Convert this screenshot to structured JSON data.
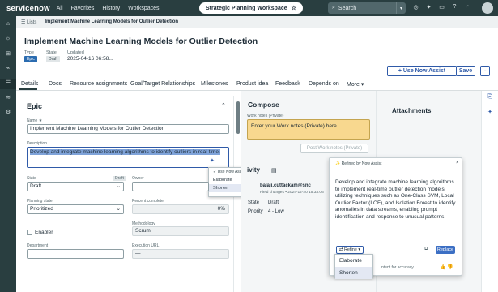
{
  "topbar": {
    "logo": "servicenow",
    "nav": [
      "All",
      "Favorites",
      "History",
      "Workspaces"
    ],
    "workspace": "Strategic Planning Workspace",
    "search_placeholder": "Search"
  },
  "tabsbar": {
    "list_tab": "Lists",
    "current_tab": "Implement Machine Learning Models for Outlier Detection"
  },
  "record": {
    "title": "Implement Machine Learning Models for Outlier Detection",
    "type_label": "Type",
    "type_value": "Epic",
    "state_label": "State",
    "state_value": "Draft",
    "updated_label": "Updated",
    "updated_value": "2025-04-16 06:58..."
  },
  "actions": {
    "use_now_assist": "+ Use Now Assist",
    "save": "Save",
    "more": "···"
  },
  "form_tabs": [
    "Details",
    "Docs",
    "Resource assignments",
    "Goal/Target Relationships",
    "Milestones",
    "Product idea",
    "Feedback",
    "Depends on",
    "More ▾"
  ],
  "form": {
    "section": "Epic",
    "name_label": "Name ★",
    "name_value": "Implement Machine Learning Models for Outlier Detection",
    "description_label": "Description",
    "description_value": "Develop and integrate machine learning algorithms to identify outliers in real-time.",
    "state_label": "State",
    "state_badge": "Draft",
    "state_value": "Draft",
    "owner_label": "Owner",
    "planning_state_label": "Planning state",
    "planning_state_value": "Prioritized",
    "percent_label": "Percent complete",
    "percent_value": "0%",
    "methodology_label": "Methodology",
    "methodology_value": "Scrum",
    "enabler_label": "Enabler",
    "department_label": "Department",
    "execution_url_label": "Execution URL",
    "execution_url_value": "—"
  },
  "desc_menu": {
    "header": "✓ Use Now Assist to...",
    "items": [
      "Elaborate",
      "Shorten"
    ]
  },
  "compose": {
    "title": "Compose",
    "notes_label": "Work notes (Private)",
    "notes_placeholder": "Enter your Work notes (Private) here",
    "post_button": "Post Work notes (Private)"
  },
  "activity": {
    "title": "ivity",
    "user": "balaji.cuttackam@snc",
    "change": "Field changes • 2024-12-20 15:33:06",
    "state_label": "State",
    "state_value": "Draft",
    "priority_label": "Priority",
    "priority_value": "4 - Low"
  },
  "attachments": {
    "title": "Attachments"
  },
  "assist_panel": {
    "header": "✨ Refined by Now Assist",
    "body": "Develop and integrate machine learning algorithms to implement real-time outlier detection models, utilizing techniques such as One-Class SVM, Local Outlier Factor (LOF), and Isolation Forest to identify anomalies in data streams, enabling prompt identification and response to unusual patterns.",
    "refine": "⇄ Refine ▾",
    "replace": "Replace",
    "disclaimer": "ntent for accuracy.",
    "refine_items": [
      "Elaborate",
      "Shorten"
    ]
  }
}
